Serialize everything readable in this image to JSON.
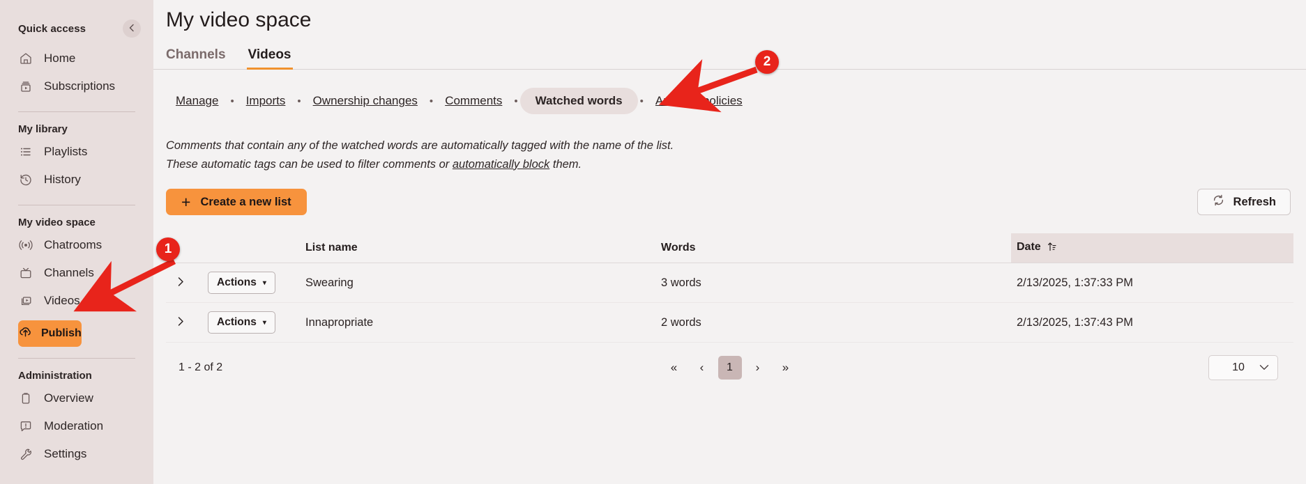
{
  "sidebar": {
    "quick_access_label": "Quick access",
    "collapse_icon": "chevron-left-icon",
    "quick_access_items": [
      {
        "label": "Home",
        "icon": "home-icon"
      },
      {
        "label": "Subscriptions",
        "icon": "subscriptions-icon"
      }
    ],
    "my_library_label": "My library",
    "my_library_items": [
      {
        "label": "Playlists",
        "icon": "playlist-icon"
      },
      {
        "label": "History",
        "icon": "history-icon"
      }
    ],
    "my_video_space_label": "My video space",
    "my_video_space_items": [
      {
        "label": "Chatrooms",
        "icon": "broadcast-icon"
      },
      {
        "label": "Channels",
        "icon": "tv-icon"
      },
      {
        "label": "Videos",
        "icon": "video-stack-icon"
      }
    ],
    "publish_label": "Publish",
    "publish_icon": "upload-cloud-icon",
    "administration_label": "Administration",
    "administration_items": [
      {
        "label": "Overview",
        "icon": "clipboard-icon"
      },
      {
        "label": "Moderation",
        "icon": "comment-alert-icon"
      },
      {
        "label": "Settings",
        "icon": "wrench-icon"
      }
    ]
  },
  "header": {
    "title": "My video space"
  },
  "tabs": [
    {
      "label": "Channels",
      "active": false
    },
    {
      "label": "Videos",
      "active": true
    }
  ],
  "subtabs": [
    {
      "label": "Manage",
      "active": false
    },
    {
      "label": "Imports",
      "active": false
    },
    {
      "label": "Ownership changes",
      "active": false
    },
    {
      "label": "Comments",
      "active": false
    },
    {
      "label": "Watched words",
      "active": true
    },
    {
      "label": "Auto tag policies",
      "active": false
    }
  ],
  "description": {
    "line1": "Comments that contain any of the watched words are automatically tagged with the name of the list.",
    "line2_before": "These automatic tags can be used to filter comments or ",
    "line2_link": "automatically block",
    "line2_after": " them."
  },
  "toolbar": {
    "create_label": "Create a new list",
    "create_icon": "plus-icon",
    "refresh_label": "Refresh",
    "refresh_icon": "refresh-icon"
  },
  "table": {
    "columns": [
      "",
      "",
      "List name",
      "Words",
      "Date"
    ],
    "sort_column": "Date",
    "sort_icon": "sort-ascending-icon",
    "row_action_label": "Actions",
    "expand_icon": "chevron-right-icon",
    "rows": [
      {
        "name": "Swearing",
        "words": "3 words",
        "date": "2/13/2025, 1:37:33 PM"
      },
      {
        "name": "Innapropriate",
        "words": "2 words",
        "date": "2/13/2025, 1:37:43 PM"
      }
    ]
  },
  "pagination": {
    "count_label": "1 - 2 of 2",
    "first_label": "«",
    "prev_label": "‹",
    "next_label": "›",
    "last_label": "»",
    "pages": [
      "1"
    ],
    "current_page": "1",
    "page_size": "10",
    "page_size_icon": "chevron-down-icon"
  },
  "annotations": [
    {
      "label": "1"
    },
    {
      "label": "2"
    }
  ],
  "colors": {
    "accent": "#f7933d",
    "sidebar_bg": "#e8dedd",
    "main_bg": "#f4f2f2",
    "annotation": "#e8241b",
    "tab_underline": "#f0912e"
  }
}
